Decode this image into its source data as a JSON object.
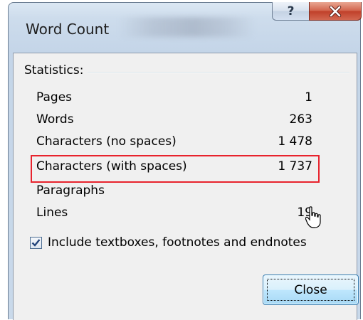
{
  "dialog": {
    "title": "Word Count",
    "help_glyph": "?",
    "close_glyph": "x"
  },
  "statistics": {
    "heading": "Statistics:",
    "rows": [
      {
        "label": "Pages",
        "value": "1"
      },
      {
        "label": "Words",
        "value": "263"
      },
      {
        "label": "Characters (no spaces)",
        "value": "1 478"
      },
      {
        "label": "Characters (with spaces)",
        "value": "1 737"
      },
      {
        "label": "Paragraphs",
        "value": ""
      },
      {
        "label": "Lines",
        "value": "19"
      }
    ]
  },
  "options": {
    "include_textboxes_label": "Include textboxes, footnotes and endnotes",
    "include_textboxes_checked": true
  },
  "buttons": {
    "close_label": "Close"
  },
  "colors": {
    "highlight": "#e8232d",
    "close_x_button": "#c0402a"
  }
}
